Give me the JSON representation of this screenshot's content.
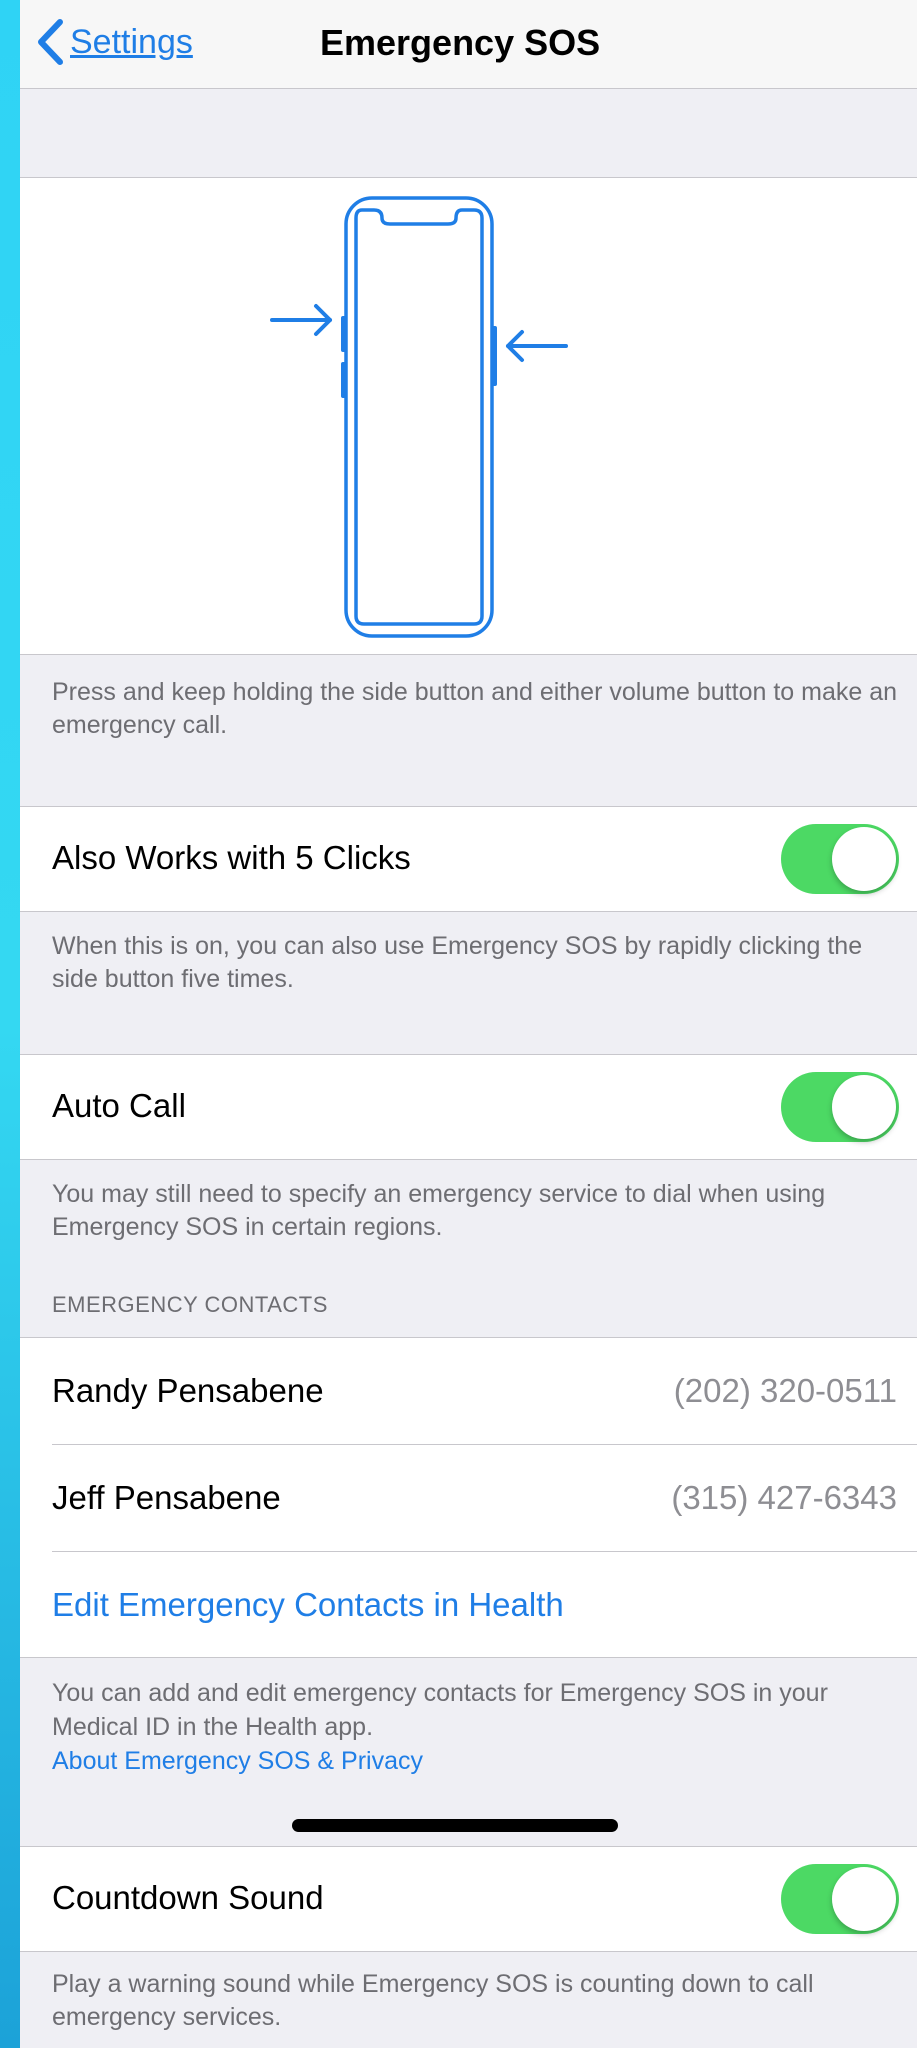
{
  "nav": {
    "back_label": "Settings",
    "title": "Emergency SOS"
  },
  "illustration": {
    "icon": "phone-side-buttons-diagram",
    "caption": "Press and keep holding the side button and either volume button to make an emergency call."
  },
  "five_clicks": {
    "label": "Also Works with 5 Clicks",
    "enabled": true,
    "footer": "When this is on, you can also use Emergency SOS by rapidly clicking the side button five times."
  },
  "auto_call": {
    "label": "Auto Call",
    "enabled": true,
    "footer": "You may still need to specify an emergency service to dial when using Emergency SOS in certain regions."
  },
  "contacts": {
    "header": "EMERGENCY CONTACTS",
    "items": [
      {
        "name": "Randy Pensabene",
        "phone": "(202) 320-0511"
      },
      {
        "name": "Jeff Pensabene",
        "phone": "(315) 427-6343"
      }
    ],
    "edit_link": "Edit Emergency Contacts in Health",
    "footer": "You can add and edit emergency contacts for Emergency SOS in your Medical ID in the Health app.",
    "privacy_link": "About Emergency SOS & Privacy"
  },
  "countdown": {
    "label": "Countdown Sound",
    "enabled": true,
    "footer": "Play a warning sound while Emergency SOS is counting down to call emergency services."
  },
  "colors": {
    "accent": "#1f7ee6",
    "toggle_on": "#4cd964",
    "grouped_bg": "#efeff4"
  }
}
